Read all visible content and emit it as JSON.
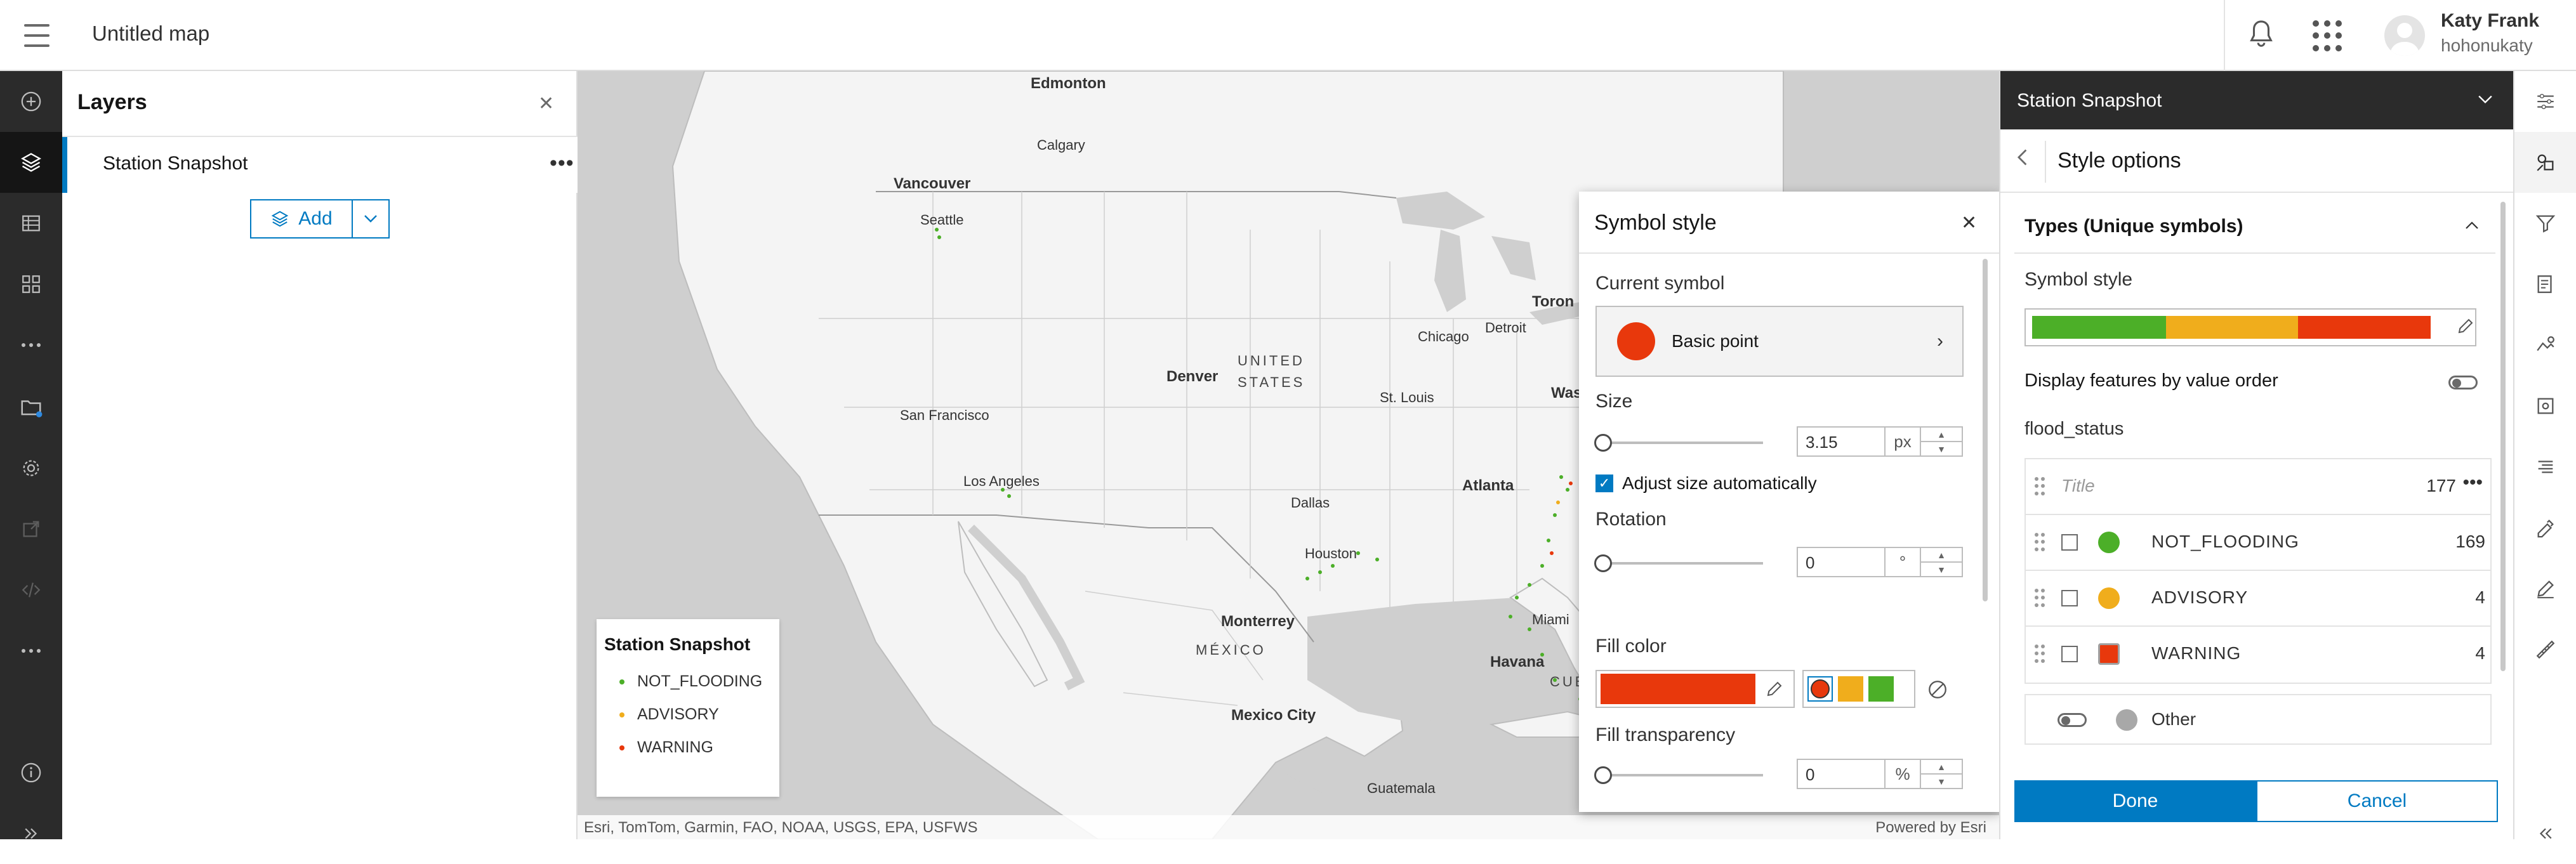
{
  "topbar": {
    "title": "Untitled map",
    "user_name": "Katy Frank",
    "user_handle": "hohonukaty"
  },
  "left_rail": {
    "items": [
      {
        "name": "add",
        "icon": "plus-circle-icon"
      },
      {
        "name": "layers",
        "icon": "layers-icon",
        "active": true
      },
      {
        "name": "tables",
        "icon": "table-icon"
      },
      {
        "name": "basemap",
        "icon": "basemap-icon"
      },
      {
        "name": "more",
        "icon": "ellipsis-icon"
      },
      {
        "name": "save",
        "icon": "folder-icon",
        "badge": true
      },
      {
        "name": "settings",
        "icon": "gear-icon"
      },
      {
        "name": "share",
        "icon": "share-icon",
        "disabled": true
      },
      {
        "name": "embed",
        "icon": "code-icon",
        "disabled": true
      },
      {
        "name": "more-2",
        "icon": "ellipsis-icon"
      },
      {
        "name": "info",
        "icon": "info-icon"
      },
      {
        "name": "expand",
        "icon": "chevrons-right-icon"
      }
    ]
  },
  "layers_panel": {
    "title": "Layers",
    "layer_name": "Station Snapshot",
    "add_label": "Add"
  },
  "map": {
    "labels": {
      "edmonton": "Edmonton",
      "calgary": "Calgary",
      "vancouver": "Vancouver",
      "seattle": "Seattle",
      "san_francisco": "San Francisco",
      "los_angeles": "Los Angeles",
      "denver": "Denver",
      "united_states_1": "UNITED",
      "united_states_2": "STATES",
      "chicago": "Chicago",
      "detroit": "Detroit",
      "toronto": "Toron",
      "washington": "Was",
      "st_louis": "St. Louis",
      "dallas": "Dallas",
      "atlanta": "Atlanta",
      "houston": "Houston",
      "monterrey": "Monterrey",
      "mexico": "MÉXICO",
      "miami": "Miami",
      "havana": "Havana",
      "cuba": "CUB",
      "mexico_city": "Mexico City",
      "guatemala": "Guatemala"
    },
    "attribution": "Esri, TomTom, Garmin, FAO, NOAA, USGS, EPA, USFWS",
    "powered_by": "Powered by Esri"
  },
  "legend": {
    "title": "Station Snapshot",
    "items": [
      {
        "label": "NOT_FLOODING",
        "color": "#4caf28"
      },
      {
        "label": "ADVISORY",
        "color": "#f0ad1c"
      },
      {
        "label": "WARNING",
        "color": "#e8380c"
      }
    ]
  },
  "symbol_style": {
    "title": "Symbol style",
    "current_symbol_label": "Current symbol",
    "current_symbol_name": "Basic point",
    "size_label": "Size",
    "size_value": "3.15",
    "size_unit": "px",
    "adjust_label": "Adjust size automatically",
    "rotation_label": "Rotation",
    "rotation_value": "0",
    "rotation_unit": "°",
    "fill_color_label": "Fill color",
    "fill_color": "#e8380c",
    "fill_ramp": [
      "#e8380c",
      "#f0ad1c",
      "#4caf28"
    ],
    "fill_transparency_label": "Fill transparency",
    "transparency_value": "0",
    "transparency_unit": "%"
  },
  "style_panel": {
    "layer_title": "Station Snapshot",
    "subtitle": "Style options",
    "section_title": "Types (Unique symbols)",
    "symbol_style_label": "Symbol style",
    "ramp_colors": [
      "#4caf28",
      "#f0ad1c",
      "#e8380c"
    ],
    "display_order_label": "Display features by value order",
    "field_label": "flood_status",
    "list_title_placeholder": "Title",
    "total_count": "177",
    "values": [
      {
        "label": "NOT_FLOODING",
        "count": "169",
        "color": "#4caf28"
      },
      {
        "label": "ADVISORY",
        "count": "4",
        "color": "#f0ad1c"
      },
      {
        "label": "WARNING",
        "count": "4",
        "color": "#e8380c"
      }
    ],
    "other_label": "Other",
    "done_label": "Done",
    "cancel_label": "Cancel"
  },
  "tool_rail": {
    "items": [
      "properties-icon",
      "styles-icon",
      "filter-icon",
      "fields-icon",
      "pop-ups-icon",
      "configure-icon",
      "labels-icon",
      "sketch-icon",
      "edit-icon",
      "measure-icon",
      "collapse-icon"
    ]
  }
}
